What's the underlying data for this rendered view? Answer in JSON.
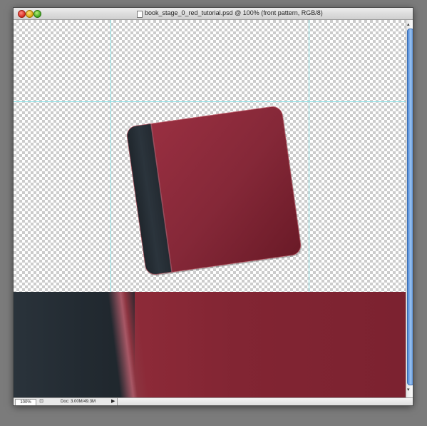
{
  "window": {
    "title": "book_stage_0_red_tutorial.psd @ 100% (front pattern, RGB/8)"
  },
  "status": {
    "zoom": "100%",
    "doc_info": "Doc: 3.00M/49.3M"
  },
  "icons": {
    "close": "close-button",
    "minimize": "minimize-button",
    "zoom": "zoom-button",
    "document": "psd-document-icon",
    "status_nav": "status-bar-icon",
    "status_menu": "triangle-right-icon"
  },
  "colors": {
    "book_cover": "#8e2b3a",
    "book_spine": "#252d34",
    "guides": "#8fe3e8",
    "scroll_thumb": "#4c88d8"
  }
}
